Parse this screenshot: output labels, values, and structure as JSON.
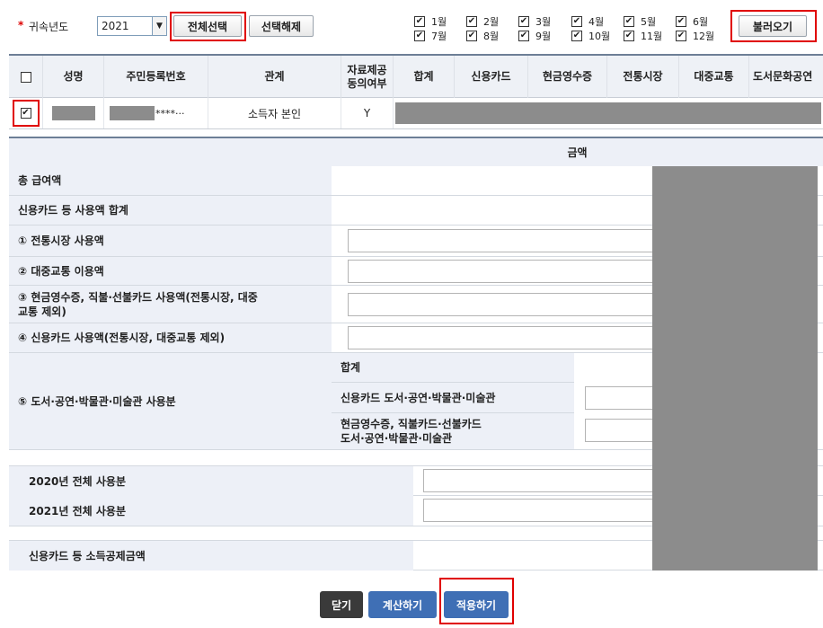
{
  "top": {
    "year_label": "귀속년도",
    "year_value": "2021",
    "select_all": "전체선택",
    "deselect_all": "선택해제",
    "load": "불러오기",
    "months": [
      "1월",
      "2월",
      "3월",
      "4월",
      "5월",
      "6월",
      "7월",
      "8월",
      "9월",
      "10월",
      "11월",
      "12월"
    ]
  },
  "header": {
    "name": "성명",
    "ssn": "주민등록번호",
    "relation": "관계",
    "consent_line1": "자료제공",
    "consent_line2": "동의여부",
    "total": "합계",
    "credit": "신용카드",
    "cash": "현금영수증",
    "market": "전통시장",
    "transit": "대중교통",
    "culture": "도서문화공연"
  },
  "row": {
    "checkmark": "✔",
    "ssn_suffix": "****···",
    "relation": "소득자 본인",
    "consent": "Y"
  },
  "form": {
    "amount_header": "금액",
    "total_salary": "총 급여액",
    "card_total": "신용카드 등 사용액 합계",
    "item1": "① 전통시장 사용액",
    "item2": "② 대중교통 이용액",
    "item3_line1": "③ 현금영수증, 직불·선불카드 사용액(전통시장, 대중",
    "item3_line2": "교통 제외)",
    "item4": "④ 신용카드 사용액(전통시장, 대중교통 제외)",
    "item5": "⑤ 도서·공연·박물관·미술관 사용분",
    "sub_total": "합계",
    "sub_credit": "신용카드 도서·공연·박물관·미술관",
    "sub_cash_line1": "현금영수증, 직불카드·선불카드",
    "sub_cash_line2": "도서·공연·박물관·미술관",
    "y2020": "2020년 전체 사용분",
    "y2021": "2021년 전체 사용분",
    "deduction": "신용카드 등 소득공제금액"
  },
  "buttons": {
    "close": "닫기",
    "calc": "계산하기",
    "apply": "적용하기"
  },
  "colors": {
    "highlight": "#e00000",
    "header_bg": "#eef1f6",
    "masked": "#8c8c8c",
    "close_btn": "#3a3a3a",
    "blue_btn": "#3f6fb5"
  }
}
